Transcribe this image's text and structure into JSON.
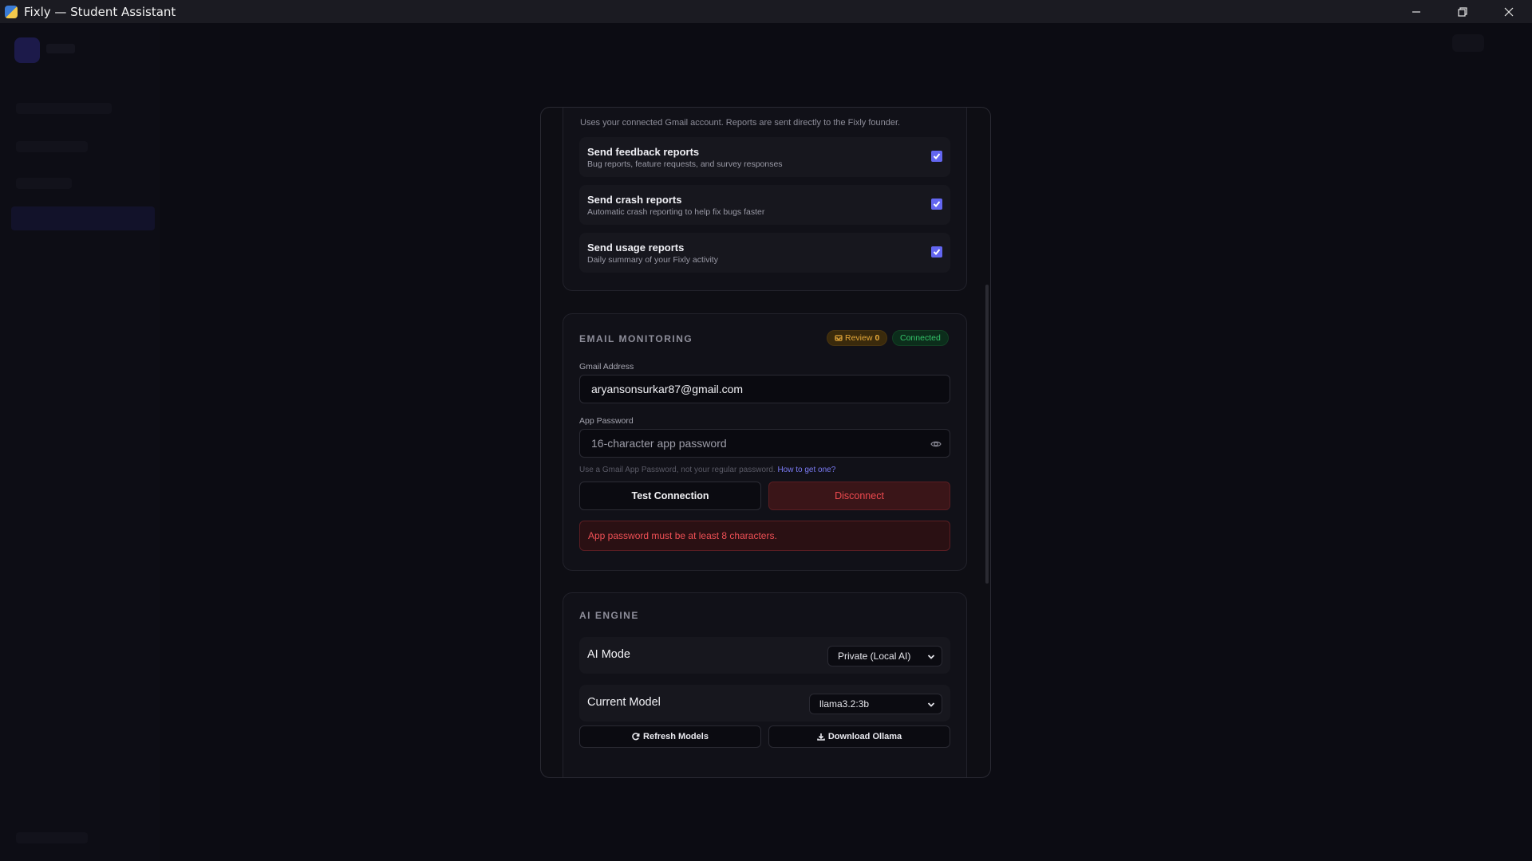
{
  "window": {
    "title": "Fixly — Student Assistant",
    "minimize_icon": "minimize-icon",
    "restore_icon": "restore-icon",
    "close_icon": "close-icon"
  },
  "reports": {
    "note": "Uses your connected Gmail account. Reports are sent directly to the Fixly founder.",
    "items": [
      {
        "title": "Send feedback reports",
        "subtitle": "Bug reports, feature requests, and survey responses",
        "checked": true
      },
      {
        "title": "Send crash reports",
        "subtitle": "Automatic crash reporting to help fix bugs faster",
        "checked": true
      },
      {
        "title": "Send usage reports",
        "subtitle": "Daily summary of your Fixly activity",
        "checked": true
      }
    ]
  },
  "email_monitoring": {
    "title": "EMAIL MONITORING",
    "review_label": "Review",
    "review_count": "0",
    "status": "Connected",
    "gmail_label": "Gmail Address",
    "gmail_value": "aryansonsurkar87@gmail.com",
    "password_label": "App Password",
    "password_placeholder": "16-character app password",
    "help_text": "Use a Gmail App Password, not your regular password.",
    "help_link": "How to get one?",
    "test_button": "Test Connection",
    "disconnect_button": "Disconnect",
    "error": "App password must be at least 8 characters."
  },
  "ai_engine": {
    "title": "AI ENGINE",
    "mode_label": "AI Mode",
    "mode_value": "Private (Local AI)",
    "model_label": "Current Model",
    "model_value": "llama3.2:3b",
    "refresh_button": "Refresh Models",
    "download_button": "Download Ollama"
  },
  "colors": {
    "accent": "#6366f1",
    "success": "#34c46a",
    "danger": "#ef4a4f",
    "warning": "#e6a93a"
  }
}
